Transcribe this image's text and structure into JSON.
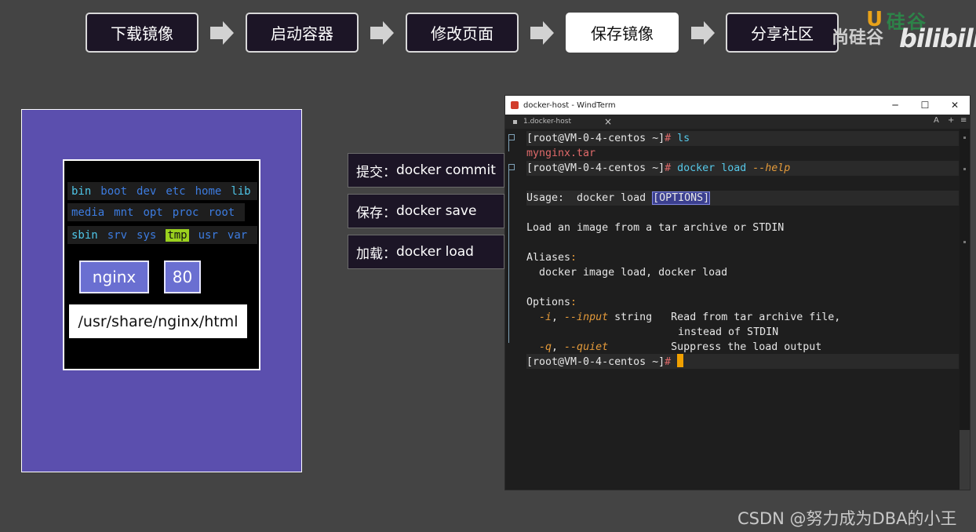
{
  "flow": {
    "steps": [
      "下载镜像",
      "启动容器",
      "修改页面",
      "保存镜像",
      "分享社区"
    ],
    "active_step": "保存镜像"
  },
  "watermark": {
    "brand": "尚硅谷",
    "site_logo": "U 硅谷",
    "platform": "bilibili",
    "csdn": "CSDN @努力成为DBA的小王"
  },
  "diagram": {
    "dirs": {
      "row1": [
        "bin",
        "boot",
        "dev",
        "etc",
        "home",
        "lib"
      ],
      "row2": [
        "media",
        "mnt",
        "opt",
        "proc",
        "root"
      ],
      "row3": [
        "sbin",
        "srv",
        "sys",
        "tmp",
        "usr",
        "var"
      ]
    },
    "container_label": "nginx",
    "port_label": "80",
    "path_label": "/usr/share/nginx/html"
  },
  "commands": [
    {
      "label": "提交：",
      "cmd": "docker commit"
    },
    {
      "label": "保存：",
      "cmd": "docker save"
    },
    {
      "label": "加载：",
      "cmd": "docker load"
    }
  ],
  "window": {
    "title": "docker-host - WindTerm",
    "tab_label": "1.docker-host",
    "tab_close": "×",
    "controls": {
      "minimize": "─",
      "maximize": "☐",
      "close": "✕"
    },
    "tab_controls": [
      "A",
      "+",
      "≡"
    ]
  },
  "terminal": {
    "prompt": "[root@VM-0-4-centos ~]",
    "hash": "#",
    "cmd1": "ls",
    "out1": "mynginx.tar",
    "cmd2_a": "docker load ",
    "cmd2_b": "--help",
    "usage_label": "Usage:",
    "usage_text": "  docker load ",
    "usage_opt": "[OPTIONS]",
    "desc": "Load an image from a tar archive or STDIN",
    "aliases_label": "Aliases",
    "aliases_colon": ":",
    "aliases_text": "  docker image load, docker load",
    "options_label": "Options",
    "options_colon": ":",
    "opt1_flag": "-i",
    "opt1_comma": ", ",
    "opt1_long": "--input",
    "opt1_type": " string",
    "opt1_desc": "Read from tar archive file,",
    "opt1_desc2": "instead of STDIN",
    "opt2_flag": "-q",
    "opt2_comma": ", ",
    "opt2_long": "--quiet",
    "opt2_desc": "Suppress the load output"
  }
}
